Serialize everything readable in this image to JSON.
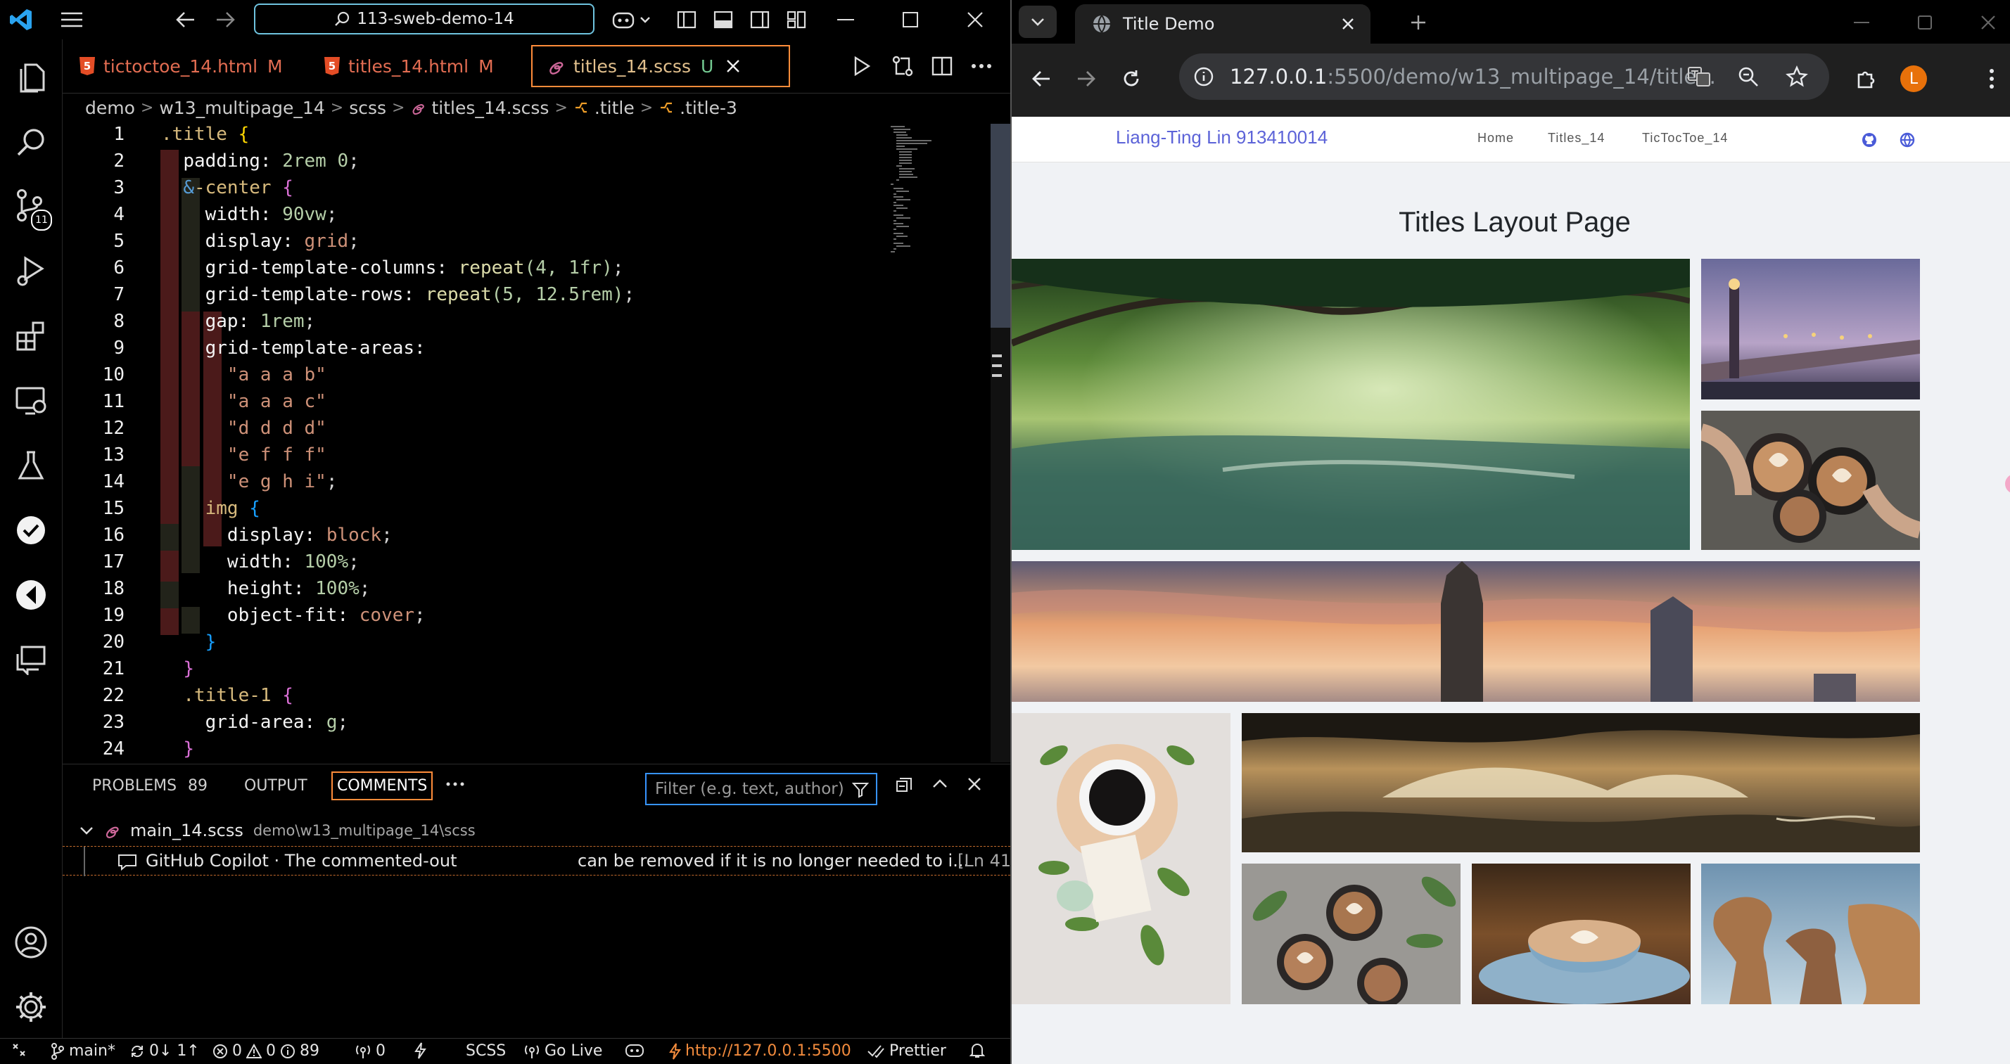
{
  "vscode": {
    "search_text": "113-sweb-demo-14",
    "tabs": [
      {
        "label": "tictoctoe_14.html",
        "status": "M"
      },
      {
        "label": "titles_14.html",
        "status": "M"
      },
      {
        "label": "titles_14.scss",
        "status": "U"
      }
    ],
    "breadcrumb": [
      "demo",
      "w13_multipage_14",
      "scss",
      "titles_14.scss",
      ".title",
      ".title-3"
    ],
    "line_numbers": [
      "1",
      "2",
      "3",
      "4",
      "5",
      "6",
      "7",
      "8",
      "9",
      "10",
      "11",
      "12",
      "13",
      "14",
      "15",
      "16",
      "17",
      "18",
      "19",
      "20",
      "21",
      "22",
      "23",
      "24"
    ],
    "code": {
      "l1_sel": ".title",
      "l1_br": "{",
      "l2_prop": "padding:",
      "l2_val": "2rem 0",
      "l3_amp": "&",
      "l3_sel": "-center",
      "l3_br": "{",
      "l4_prop": "width:",
      "l4_val": "90vw",
      "l5_prop": "display:",
      "l5_val": "grid",
      "l6_prop": "grid-template-columns:",
      "l6_fn": "repeat",
      "l6_args": "(4, 1fr)",
      "l7_prop": "grid-template-rows:",
      "l7_fn": "repeat",
      "l7_args": "(5, 12.5rem)",
      "l8_prop": "gap:",
      "l8_val": "1rem",
      "l9_prop": "grid-template-areas:",
      "l10": "\"a a a b\"",
      "l11": "\"a a a c\"",
      "l12": "\"d d d d\"",
      "l13": "\"e f f f\"",
      "l14": "\"e g h i\"",
      "l15_tag": "img",
      "l15_br": "{",
      "l16_prop": "display:",
      "l16_val": "block",
      "l17_prop": "width:",
      "l17_val": "100%",
      "l18_prop": "height:",
      "l18_val": "100%",
      "l19_prop": "object-fit:",
      "l19_val": "cover",
      "l20_br": "}",
      "l21_br": "}",
      "l22_sel": ".title-1",
      "l22_br": "{",
      "l23_prop": "grid-area:",
      "l23_val": "g",
      "l24_br": "}"
    },
    "panel": {
      "tabs": [
        "PROBLEMS",
        "OUTPUT",
        "COMMENTS"
      ],
      "problems_count": "89",
      "filter_placeholder": "Filter (e.g. text, author)",
      "tree_file": "main_14.scss",
      "tree_path": "demo\\w13_multipage_14\\scss",
      "comment_author": "GitHub Copilot · The commented-out",
      "comment_text": "can be removed if it is no longer needed to i...",
      "comment_loc": "[Ln 41"
    },
    "status": {
      "branch": "main*",
      "sync": "0↓ 1↑",
      "errors": "0",
      "warnings": "0",
      "infos": "89",
      "ports": "0",
      "language": "SCSS",
      "golive": "Go Live",
      "server_url": "http://127.0.0.1:5500",
      "prettier": "Prettier"
    },
    "activity_badge": "11"
  },
  "browser": {
    "tab_title": "Title Demo",
    "url_host": "127.0.0.1",
    "url_rest": ":5500/demo/w13_multipage_14/title...",
    "profile_initial": "L",
    "page": {
      "brand": "Liang-Ting Lin 913410014",
      "nav": [
        "Home",
        "Titles_14",
        "TicTocToe_14"
      ],
      "title": "Titles Layout Page"
    }
  },
  "colors": {
    "accent_blue": "#3794ff",
    "active_tab_border": "#ff8c3a",
    "brand": "#5c63d8",
    "profile": "#e8710a"
  }
}
